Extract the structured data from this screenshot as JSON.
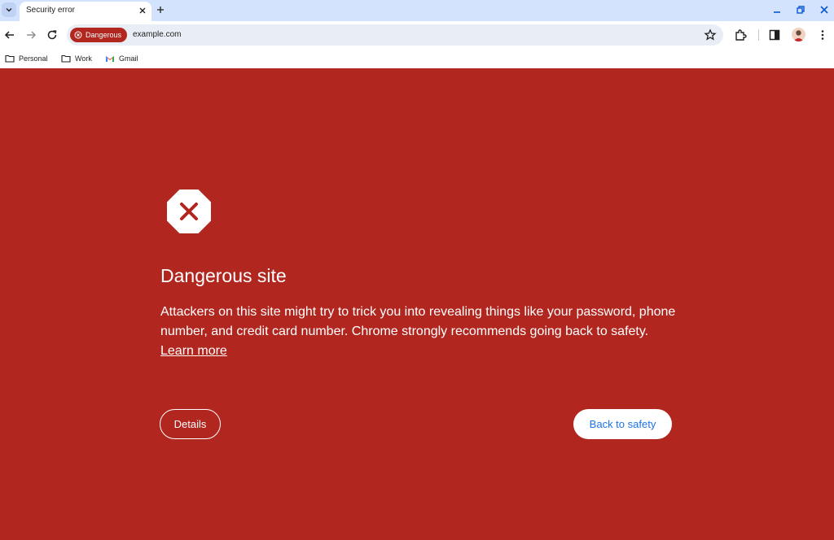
{
  "browser": {
    "tab": {
      "title": "Security error"
    },
    "omnibox": {
      "security_chip": "Dangerous",
      "url": "example.com"
    },
    "bookmarks": [
      {
        "label": "Personal",
        "icon": "folder-icon"
      },
      {
        "label": "Work",
        "icon": "folder-icon"
      },
      {
        "label": "Gmail",
        "icon": "gmail-icon"
      }
    ]
  },
  "interstitial": {
    "icon": "danger-octagon-icon",
    "title": "Dangerous site",
    "body": "Attackers on this site might try to trick you into revealing things like your password, phone number, and credit card number. Chrome strongly recommends going back to safety.",
    "learn_more": "Learn more",
    "details_button": "Details",
    "back_button": "Back to safety"
  },
  "colors": {
    "danger_background": "#b1261f",
    "tabstrip": "#d3e3fd",
    "link_blue": "#1a73e8"
  }
}
